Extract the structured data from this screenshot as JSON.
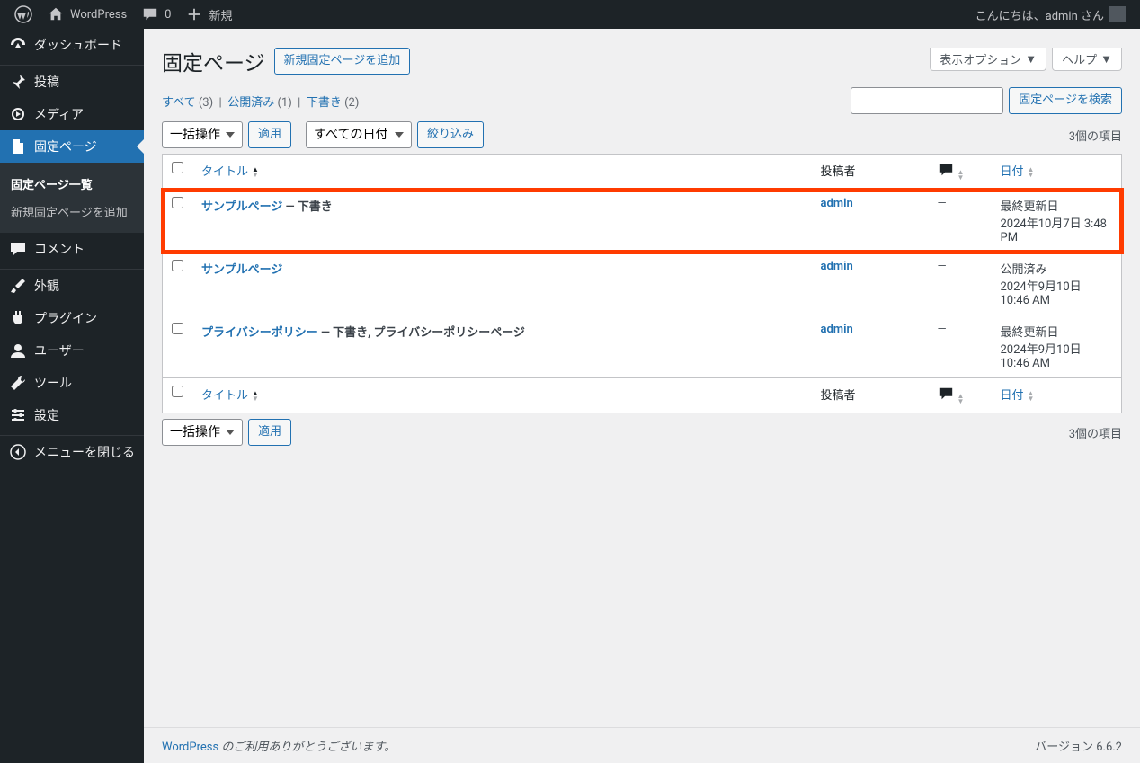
{
  "adminbar": {
    "site_name": "WordPress",
    "comments": "0",
    "new": "新規",
    "greeting": "こんにちは、admin さん"
  },
  "sidebar": {
    "dashboard": "ダッシュボード",
    "posts": "投稿",
    "media": "メディア",
    "pages": "固定ページ",
    "pages_list": "固定ページ一覧",
    "pages_add": "新規固定ページを追加",
    "comments": "コメント",
    "appearance": "外観",
    "plugins": "プラグイン",
    "users": "ユーザー",
    "tools": "ツール",
    "settings": "設定",
    "collapse": "メニューを閉じる"
  },
  "screen_options": "表示オプション",
  "help": "ヘルプ",
  "page_title": "固定ページ",
  "add_new": "新規固定ページを追加",
  "filters": {
    "all": "すべて",
    "all_count": "(3)",
    "published": "公開済み",
    "published_count": "(1)",
    "draft": "下書き",
    "draft_count": "(2)"
  },
  "search_btn": "固定ページを検索",
  "bulk_action": "一括操作",
  "apply": "適用",
  "all_dates": "すべての日付",
  "filter_btn": "絞り込み",
  "items_count": "3個の項目",
  "cols": {
    "title": "タイトル",
    "author": "投稿者",
    "date": "日付"
  },
  "rows": [
    {
      "title": "サンプルページ",
      "state": " — 下書き",
      "author": "admin",
      "comments": "—",
      "date_status": "最終更新日",
      "date_line": "2024年10月7日 3:48 PM"
    },
    {
      "title": "サンプルページ",
      "state": "",
      "author": "admin",
      "comments": "—",
      "date_status": "公開済み",
      "date_line": "2024年9月10日 10:46 AM"
    },
    {
      "title": "プライバシーポリシー",
      "state": " — 下書き, プライバシーポリシーページ",
      "author": "admin",
      "comments": "—",
      "date_status": "最終更新日",
      "date_line": "2024年9月10日 10:46 AM"
    }
  ],
  "footer": {
    "thanks_pre": "WordPress",
    "thanks_post": " のご利用ありがとうございます。",
    "version": "バージョン 6.6.2"
  }
}
